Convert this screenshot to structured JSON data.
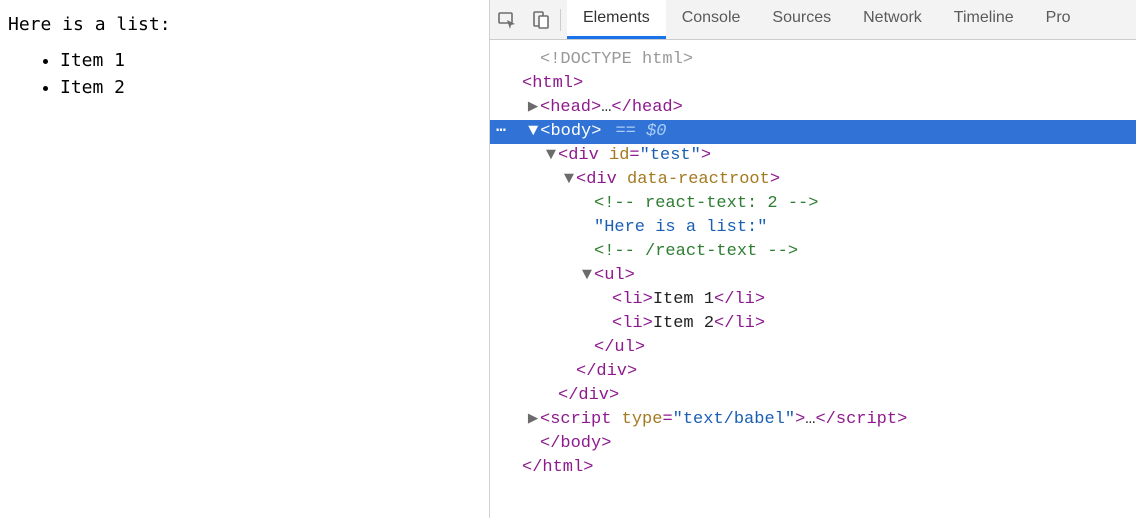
{
  "page": {
    "heading": "Here is a list:",
    "list_items": [
      "Item 1",
      "Item 2"
    ]
  },
  "devtools": {
    "tabs": [
      "Elements",
      "Console",
      "Sources",
      "Network",
      "Timeline",
      "Pro"
    ],
    "active_tab_index": 0,
    "selection_indicator": "== $0",
    "dom_lines": [
      {
        "kind": "doctype",
        "indent": 1,
        "disclosure": "",
        "tokens": [
          "<!DOCTYPE html>"
        ]
      },
      {
        "kind": "open",
        "indent": 0,
        "disclosure": "",
        "tokens": [
          "<",
          "html",
          ">"
        ]
      },
      {
        "kind": "openclose",
        "indent": 1,
        "disclosure": "right",
        "tokens": [
          "<",
          "head",
          ">",
          "…",
          "</",
          "head",
          ">"
        ]
      },
      {
        "kind": "open",
        "selected": true,
        "indent": 1,
        "disclosure": "down",
        "tokens": [
          "<",
          "body",
          ">"
        ],
        "selection_marker": true
      },
      {
        "kind": "open",
        "indent": 2,
        "disclosure": "down",
        "tokens": [
          "<",
          "div",
          " ",
          "id",
          "=",
          "\"test\"",
          ">"
        ]
      },
      {
        "kind": "open",
        "indent": 3,
        "disclosure": "down",
        "tokens": [
          "<",
          "div",
          " ",
          "data-reactroot",
          ">"
        ]
      },
      {
        "kind": "comment",
        "indent": 4,
        "disclosure": "",
        "tokens": [
          "<!-- react-text: 2 -->"
        ]
      },
      {
        "kind": "text",
        "indent": 4,
        "disclosure": "",
        "tokens": [
          "\"Here is a list:\""
        ]
      },
      {
        "kind": "comment",
        "indent": 4,
        "disclosure": "",
        "tokens": [
          "<!-- /react-text -->"
        ]
      },
      {
        "kind": "open",
        "indent": 4,
        "disclosure": "down",
        "tokens": [
          "<",
          "ul",
          ">"
        ]
      },
      {
        "kind": "openclose",
        "indent": 5,
        "disclosure": "",
        "tokens": [
          "<",
          "li",
          ">",
          "Item 1",
          "</",
          "li",
          ">"
        ]
      },
      {
        "kind": "openclose",
        "indent": 5,
        "disclosure": "",
        "tokens": [
          "<",
          "li",
          ">",
          "Item 2",
          "</",
          "li",
          ">"
        ]
      },
      {
        "kind": "close",
        "indent": 4,
        "disclosure": "",
        "tokens": [
          "</",
          "ul",
          ">"
        ]
      },
      {
        "kind": "close",
        "indent": 3,
        "disclosure": "",
        "tokens": [
          "</",
          "div",
          ">"
        ]
      },
      {
        "kind": "close",
        "indent": 2,
        "disclosure": "",
        "tokens": [
          "</",
          "div",
          ">"
        ]
      },
      {
        "kind": "openclose",
        "indent": 1,
        "disclosure": "right",
        "tokens": [
          "<",
          "script",
          " ",
          "type",
          "=",
          "\"text/babel\"",
          ">",
          "…",
          "</",
          "script",
          ">"
        ]
      },
      {
        "kind": "close",
        "indent": 1,
        "disclosure": "",
        "tokens": [
          "</",
          "body",
          ">"
        ]
      },
      {
        "kind": "close",
        "indent": 0,
        "disclosure": "",
        "tokens": [
          "</",
          "html",
          ">"
        ]
      }
    ]
  }
}
